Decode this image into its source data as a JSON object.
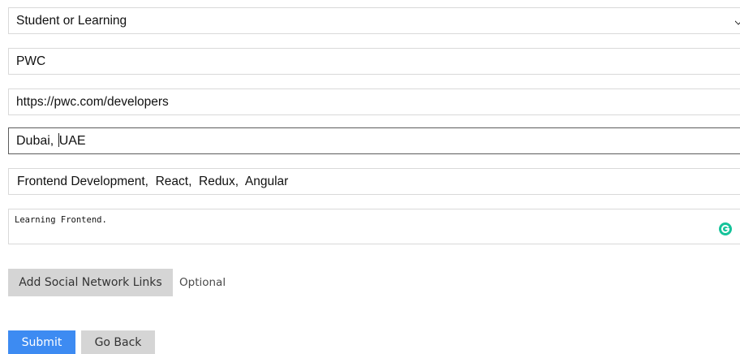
{
  "form": {
    "status_select": {
      "value": "Student or Learning",
      "icon": "chevron-down-icon"
    },
    "company": {
      "value": "PWC"
    },
    "website": {
      "value": "https://pwc.com/developers"
    },
    "location": {
      "value_before_caret": "Dubai, ",
      "value_after_caret": "UAE"
    },
    "skills": {
      "value": "Frontend Development,  React,  Redux,  Angular"
    },
    "bio": {
      "value": "Learning Frontend.",
      "extension_icon": "grammarly-icon",
      "extension_color": "#15c39a"
    },
    "social_button_label": "Add Social Network Links",
    "social_optional_text": "Optional",
    "submit_label": "Submit",
    "go_back_label": "Go Back"
  },
  "colors": {
    "primary_button": "#3d8bf2",
    "secondary_button": "#d5d5d5"
  }
}
